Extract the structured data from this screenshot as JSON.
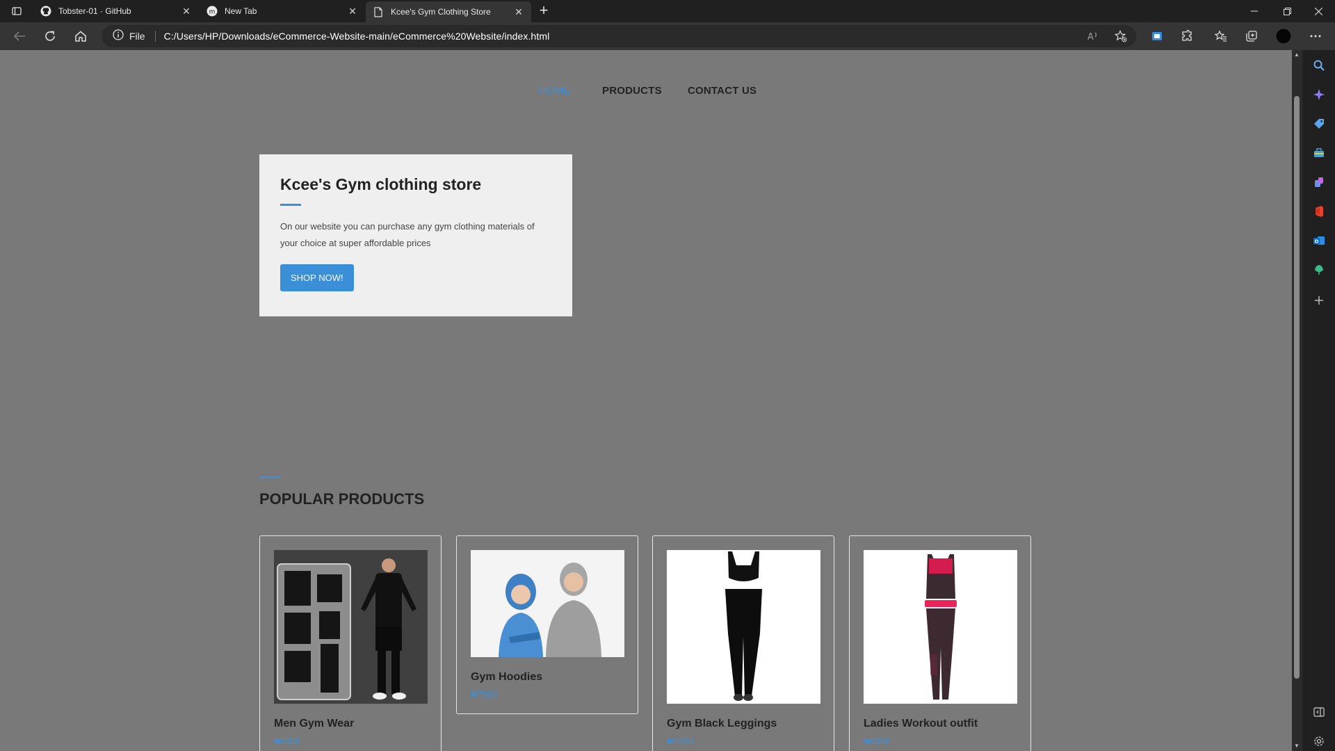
{
  "browser": {
    "tabs": [
      {
        "title": "Tobster-01 · GitHub",
        "icon": "github-icon"
      },
      {
        "title": "New Tab",
        "icon": "new-tab-icon"
      },
      {
        "title": "Kcee's Gym Clothing Store",
        "icon": "page-icon"
      }
    ],
    "address": {
      "scheme_label": "File",
      "url": "C:/Users/HP/Downloads/eCommerce-Website-main/eCommerce%20Website/index.html"
    }
  },
  "site": {
    "nav": [
      {
        "label": "HOME",
        "active": true
      },
      {
        "label": "PRODUCTS",
        "active": false
      },
      {
        "label": "CONTACT US",
        "active": false
      }
    ],
    "hero": {
      "title": "Kcee's Gym clothing store",
      "text": "On our website you can purchase any gym clothing materials of your choice at super affordable prices",
      "button": "SHOP NOW!"
    },
    "popular": {
      "title": "POPULAR PRODUCTS",
      "products": [
        {
          "name": "Men Gym Wear",
          "price": "₦5000"
        },
        {
          "name": "Gym Hoodies",
          "price": "₦7500"
        },
        {
          "name": "Gym Black Leggings",
          "price": "₦4000"
        },
        {
          "name": "Ladies Workout outfit",
          "price": "₦6000"
        }
      ]
    }
  },
  "colors": {
    "accent": "#3b8ed8",
    "page_overlay": "#797979",
    "browser_chrome": "#202020"
  }
}
